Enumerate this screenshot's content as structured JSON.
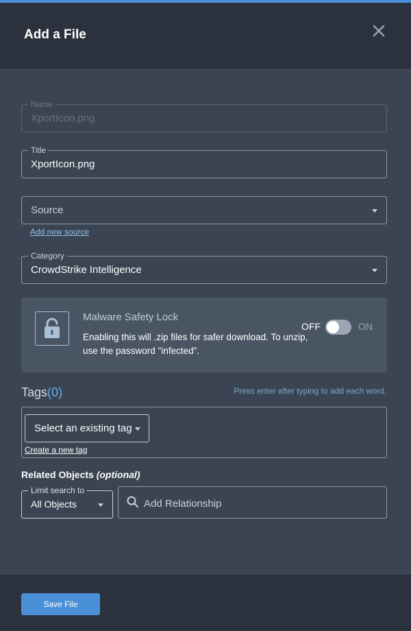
{
  "modal": {
    "title": "Add a File"
  },
  "form": {
    "name": {
      "legend": "Name",
      "value": "XportIcon.png"
    },
    "title": {
      "legend": "Title",
      "value": "XportIcon.png"
    },
    "source": {
      "placeholder": "Source",
      "add_link": "Add new source"
    },
    "category": {
      "legend": "Category",
      "value": "CrowdStrike Intelligence"
    }
  },
  "safety_lock": {
    "title": "Malware Safety Lock",
    "description": "Enabling this will .zip files for safer download. To unzip, use the password \"infected\".",
    "off_label": "OFF",
    "on_label": "ON",
    "enabled": false
  },
  "tags": {
    "label": "Tags",
    "count": "(0)",
    "hint": "Press enter after typing to add each word.",
    "select_label": "Select an existing tag",
    "create_link": "Create a new tag"
  },
  "related": {
    "label": "Related Objects",
    "optional": "(optional)",
    "limit_legend": "Limit search to",
    "limit_value": "All Objects",
    "search_placeholder": "Add Relationship"
  },
  "footer": {
    "save_label": "Save File"
  },
  "colors": {
    "accent": "#4a90d9",
    "panel_bg": "#3a4452",
    "header_bg": "#2b323d"
  }
}
